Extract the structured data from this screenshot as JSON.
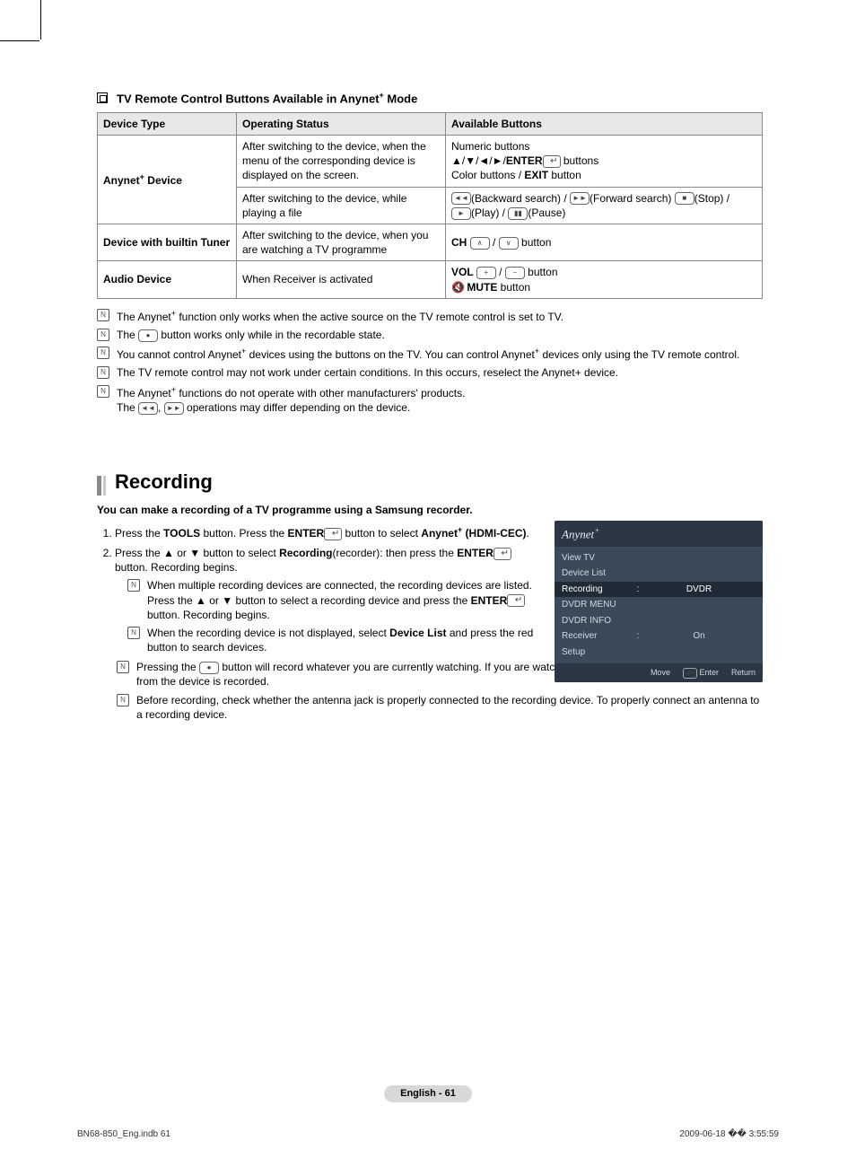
{
  "section1": {
    "subheading_pre": "TV Remote Control Buttons Available in Anynet",
    "subheading_post": " Mode",
    "sup": "+"
  },
  "table": {
    "headers": [
      "Device Type",
      "Operating Status",
      "Available Buttons"
    ],
    "rows": [
      {
        "deviceType_pre": "Anynet",
        "deviceType_sup": "+",
        "deviceType_post": " Device",
        "r1": {
          "status": "After switching to the device, when the menu of the corresponding device is displayed on the screen.",
          "buttons_line1": "Numeric buttons",
          "buttons_line2_pre": "▲/▼/◄/►/",
          "buttons_line2_bold": "ENTER",
          "buttons_line2_post": " buttons",
          "buttons_line3_pre": "Color buttons / ",
          "buttons_line3_bold": "EXIT",
          "buttons_line3_post": " button"
        },
        "r2": {
          "status": "After switching to the device, while playing a file",
          "buttons_bw": "(Backward search) / ",
          "buttons_fw": "(Forward search) ",
          "buttons_stop": "(Stop) /",
          "buttons_play": "(Play) / ",
          "buttons_pause": "(Pause)"
        }
      },
      {
        "deviceType": "Device with builtin Tuner",
        "status": "After switching to the device, when you are watching a TV programme",
        "buttons_pre": "CH ",
        "buttons_post": " button"
      },
      {
        "deviceType": "Audio Device",
        "status": "When Receiver is activated",
        "buttons_line1_pre": "VOL ",
        "buttons_line1_post": " button",
        "buttons_line2_bold": "MUTE",
        "buttons_line2_post": " button"
      }
    ]
  },
  "notes": [
    {
      "pre": "The Anynet",
      "sup": "+",
      "post": " function only works when the active source on the TV remote control is set to TV."
    },
    {
      "pre": "The ",
      "icon": "●",
      "post": " button works only while in the recordable state."
    },
    {
      "pre": "You cannot control Anynet",
      "sup": "+",
      "mid": " devices using the buttons on the TV. You can control Anynet",
      "sup2": "+",
      "post": " devices only using the TV remote control."
    },
    {
      "text": "The TV remote control may not work under certain conditions. In this occurs, reselect the Anynet+ device."
    },
    {
      "pre": "The Anynet",
      "sup": "+",
      "post": " functions do not operate with other manufacturers' products.",
      "line2_pre": "The ",
      "line2_post": " operations may differ depending on the device."
    }
  ],
  "recording": {
    "heading": "Recording",
    "lead": "You can make a recording of a TV programme using a Samsung recorder.",
    "steps": [
      {
        "n": "1.",
        "pre": "Press the ",
        "b1": "TOOLS",
        "mid": " button. Press the ",
        "b2": "ENTER",
        "mid2": "  button to select ",
        "b3": "Anynet",
        "b3sup": "+",
        "b3post": " (HDMI-CEC)",
        "end": "."
      },
      {
        "n": "2.",
        "pre": "Press the ▲ or ▼ button to select ",
        "b1": "Recording",
        "mid": "(recorder): then press the ",
        "b2": "ENTER",
        "end": " button. Recording begins.",
        "sub": [
          {
            "pre": "When multiple recording devices are connected, the recording devices are listed. Press the ▲ or ▼ button to select a recording device and press the ",
            "b1": "ENTER",
            "post": " button. Recording begins."
          },
          {
            "pre": "When the recording device is not displayed, select ",
            "b1": "Device List",
            "post": " and press the red button to search devices."
          }
        ]
      }
    ],
    "lowerNotes": [
      {
        "pre": "Pressing the ",
        "icon": "●",
        "post": " button will record whatever you are currently watching. If you are watching video from another device, the video from the device is recorded."
      },
      {
        "text": "Before recording, check whether the antenna jack is properly connected to the recording device. To properly connect an antenna to a recording device."
      }
    ]
  },
  "menu": {
    "title_pre": "Anynet",
    "title_sup": "+",
    "items": [
      {
        "label": "View TV"
      },
      {
        "label": "Device List"
      },
      {
        "label": "Recording",
        "colon": ":",
        "value": "DVDR",
        "selected": true
      },
      {
        "label": "DVDR MENU"
      },
      {
        "label": "DVDR INFO"
      },
      {
        "label": "Receiver",
        "colon": ":",
        "value": "On"
      },
      {
        "label": "Setup"
      }
    ],
    "footer": {
      "move": "Move",
      "enter": "Enter",
      "ret": "Return"
    }
  },
  "footer": {
    "center_pre": "English - ",
    "center_num": "61",
    "left": "BN68-850_Eng.indb   61",
    "right": "2009-06-18   �� 3:55:59"
  }
}
